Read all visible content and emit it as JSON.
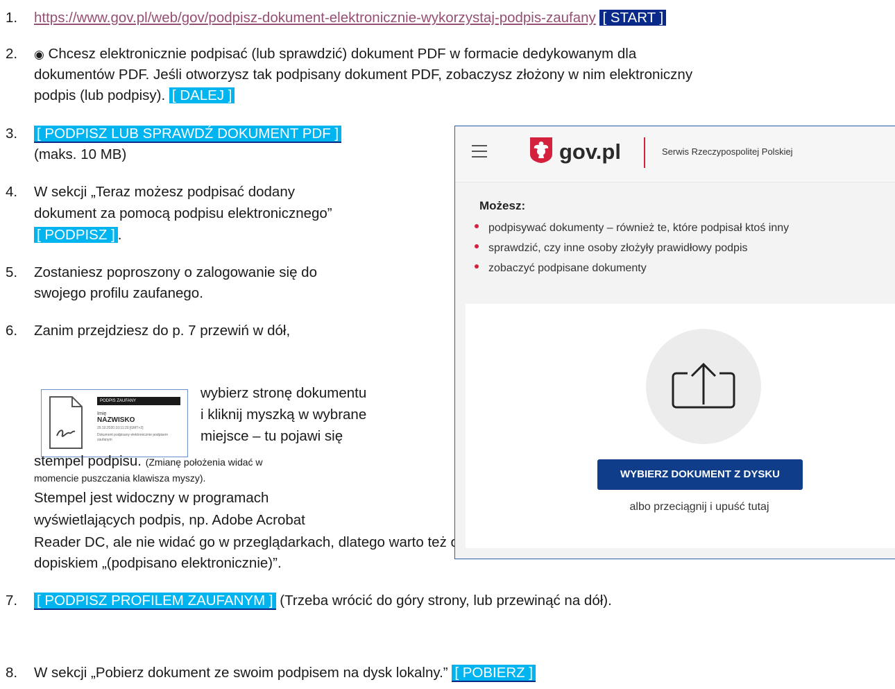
{
  "steps": {
    "s1": {
      "n": "1.",
      "url": "https://www.gov.pl/web/gov/podpisz-dokument-elektronicznie-wykorzystaj-podpis-zaufany",
      "tag": "[ START ]"
    },
    "s2": {
      "n": "2.",
      "radio": "◉",
      "l1": " Chcesz elektronicznie podpisać (lub sprawdzić) dokument PDF w formacie dedykowanym dla",
      "l2": "dokumentów PDF. Jeśli otworzysz tak podpisany dokument PDF, zobaczysz złożony w nim elektroniczny",
      "l3": "podpis (lub podpisy). ",
      "tag": "[ DALEJ ]"
    },
    "s3": {
      "n": "3.",
      "tag": "[ PODPISZ LUB SPRAWDŹ DOKUMENT PDF ]",
      "l2": "(maks. 10 MB)"
    },
    "s4": {
      "n": "4.",
      "l1": "W sekcji „Teraz możesz podpisać dodany",
      "l2": "dokument za pomocą podpisu elektronicznego”",
      "tag": "[ PODPISZ ]",
      "after": "."
    },
    "s5": {
      "n": "5.",
      "l1": "Zostaniesz poproszony o zalogowanie się do",
      "l2": "swojego profilu zaufanego."
    },
    "s6": {
      "n": "6.",
      "l1": "Zanim przejdziesz do p. 7 przewiń w dół,",
      "l2": "wybierz stronę dokumentu",
      "l3": "i kliknij myszką w wybrane",
      "l4": "miejsce – tu pojawi się",
      "l5": "stempel podpisu. ",
      "l5small": "(Zmianę położenia widać w",
      "l6small": "momencie puszczania klawisza myszy).",
      "l7": "Stempel jest widoczny w programach",
      "l8": "wyświetlających podpis, np. Adobe Acrobat",
      "l9": "Reader DC, ale nie widać go w przeglądarkach, dlatego warto też opisać w dokumencie kto go podpisuje",
      "l10": "dopiskiem „(podpisano elektronicznie)”."
    },
    "s7": {
      "n": "7.",
      "tag": "[ PODPISZ PROFILEM ZAUFANYM ]",
      "rest": " (Trzeba wrócić do góry strony, lub przewinąć na dół)."
    },
    "s8": {
      "n": "8.",
      "l1": "W sekcji „Pobierz dokument ze swoim podpisem na dysk lokalny.” ",
      "tag": "[ POBIERZ ]"
    }
  },
  "stamp": {
    "header": "PODPIS ZAUFANY",
    "imie": "Imię",
    "nazwisko": "NAZWISKO",
    "date": "29.10.2020 10:11:20 [GMT+2]",
    "note": "Dokument podpisany elektronicznie podpisem zaufanym"
  },
  "gov": {
    "brand": "gov.pl",
    "service": "Serwis Rzeczypospolitej Polskiej",
    "heading": "Możesz:",
    "items": [
      "podpisywać dokumenty – również te, które podpisał ktoś inny",
      "sprawdzić, czy inne osoby złożyły prawidłowy podpis",
      "zobaczyć podpisane dokumenty"
    ],
    "button": "WYBIERZ DOKUMENT Z DYSKU",
    "drop": "albo przeciągnij i upuść tutaj"
  },
  "colors": {
    "tag": "#00b4f0",
    "tag_dark": "#0a2a8a",
    "link": "#954f72",
    "gov_red": "#d4213d",
    "gov_button": "#0f3d8a"
  },
  "icons": {
    "menu": "hamburger-icon",
    "logo": "polish-eagle-icon",
    "upload": "upload-icon",
    "doc": "signed-document-icon"
  }
}
